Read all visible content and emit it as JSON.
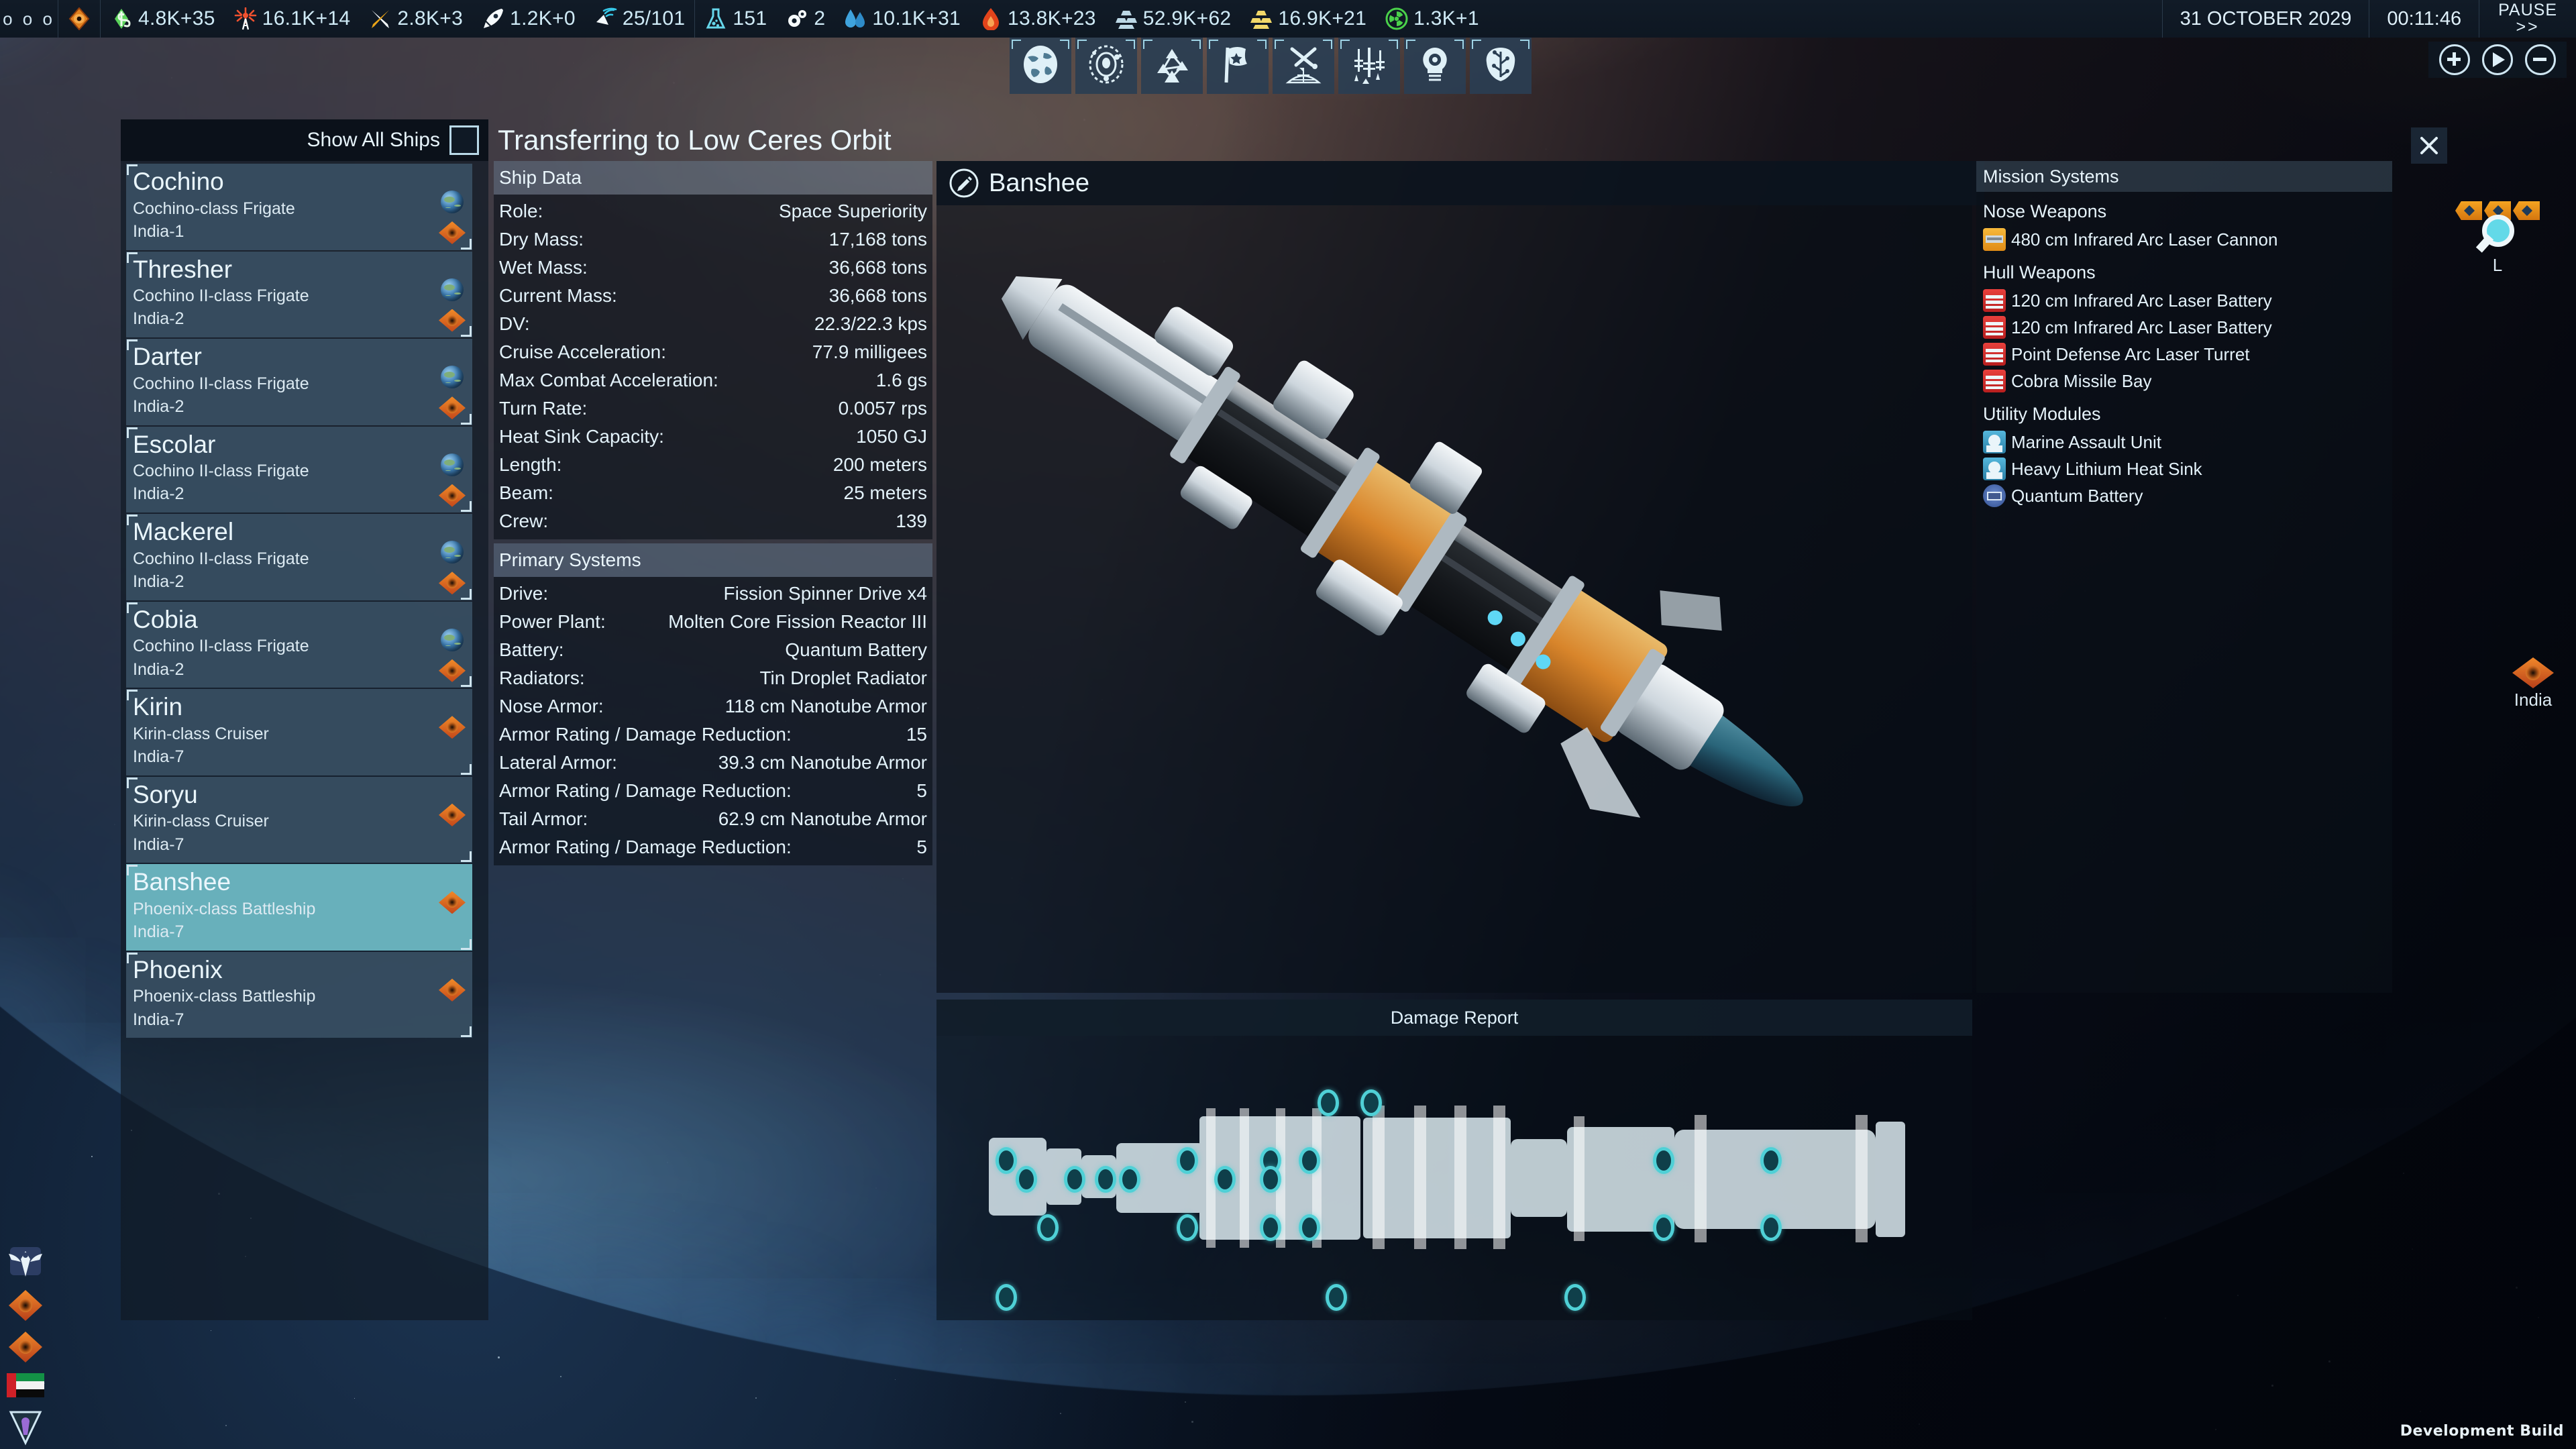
{
  "topbar": {
    "menu_dots": "o o o",
    "resources": [
      {
        "icon": "faction-eye-icon",
        "value": ""
      },
      {
        "icon": "money-icon",
        "value": "4.8K+35"
      },
      {
        "icon": "power-icon",
        "value": "16.1K+14"
      },
      {
        "icon": "metals-icon",
        "value": "2.8K+3"
      },
      {
        "icon": "rocket-icon",
        "value": "1.2K+0"
      },
      {
        "icon": "antenna-icon",
        "value": "25/101"
      },
      {
        "icon": "research-flask-icon",
        "value": "151"
      },
      {
        "icon": "gears-icon",
        "value": "2"
      },
      {
        "icon": "water-icon",
        "value": "10.1K+31"
      },
      {
        "icon": "volatiles-icon",
        "value": "13.8K+23"
      },
      {
        "icon": "metal-ingots-icon",
        "value": "52.9K+62"
      },
      {
        "icon": "gold-ingots-icon",
        "value": "16.9K+21"
      },
      {
        "icon": "fissiles-icon",
        "value": "1.3K+1"
      }
    ],
    "date": "31 OCTOBER 2029",
    "clock": "00:11:46",
    "pause_line1": "PAUSE",
    "pause_line2": ">>"
  },
  "toolbar": {
    "items": [
      {
        "name": "globe-icon",
        "label": "Earth"
      },
      {
        "name": "solar-system-icon",
        "label": "System"
      },
      {
        "name": "network-icon",
        "label": "Intel"
      },
      {
        "name": "flag-icon",
        "label": "Factions"
      },
      {
        "name": "crossed-swords-icon",
        "label": "Military"
      },
      {
        "name": "ships-icon",
        "label": "Fleets"
      },
      {
        "name": "lightbulb-gear-icon",
        "label": "Projects"
      },
      {
        "name": "brain-tech-icon",
        "label": "Research"
      }
    ]
  },
  "zoom_controls": {
    "zoom_in": "+",
    "play": "▶",
    "zoom_out": "−"
  },
  "window": {
    "title": "Transferring to Low Ceres Orbit",
    "close_label": "×"
  },
  "ship_list": {
    "show_all_label": "Show All Ships",
    "show_all_checked": false,
    "ships": [
      {
        "name": "Cochino",
        "class": "Cochino-class Frigate",
        "location": "India-1",
        "selected": false,
        "has_earth_badge": true
      },
      {
        "name": "Thresher",
        "class": "Cochino II-class Frigate",
        "location": "India-2",
        "selected": false,
        "has_earth_badge": true
      },
      {
        "name": "Darter",
        "class": "Cochino II-class Frigate",
        "location": "India-2",
        "selected": false,
        "has_earth_badge": true
      },
      {
        "name": "Escolar",
        "class": "Cochino II-class Frigate",
        "location": "India-2",
        "selected": false,
        "has_earth_badge": true
      },
      {
        "name": "Mackerel",
        "class": "Cochino II-class Frigate",
        "location": "India-2",
        "selected": false,
        "has_earth_badge": true
      },
      {
        "name": "Cobia",
        "class": "Cochino II-class Frigate",
        "location": "India-2",
        "selected": false,
        "has_earth_badge": true
      },
      {
        "name": "Kirin",
        "class": "Kirin-class Cruiser",
        "location": "India-7",
        "selected": false,
        "has_earth_badge": false
      },
      {
        "name": "Soryu",
        "class": "Kirin-class Cruiser",
        "location": "India-7",
        "selected": false,
        "has_earth_badge": false
      },
      {
        "name": "Banshee",
        "class": "Phoenix-class Battleship",
        "location": "India-7",
        "selected": true,
        "has_earth_badge": false
      },
      {
        "name": "Phoenix",
        "class": "Phoenix-class Battleship",
        "location": "India-7",
        "selected": false,
        "has_earth_badge": false
      }
    ]
  },
  "ship_data": {
    "section_title": "Ship Data",
    "rows": [
      {
        "key": "Role:",
        "value": "Space Superiority"
      },
      {
        "key": "Dry Mass:",
        "value": "17,168 tons"
      },
      {
        "key": "Wet Mass:",
        "value": "36,668 tons"
      },
      {
        "key": "Current Mass:",
        "value": "36,668 tons"
      },
      {
        "key": "DV:",
        "value": "22.3/22.3 kps"
      },
      {
        "key": "Cruise Acceleration:",
        "value": "77.9 milligees"
      },
      {
        "key": "Max Combat Acceleration:",
        "value": "1.6 gs"
      },
      {
        "key": "Turn Rate:",
        "value": "0.0057 rps"
      },
      {
        "key": "Heat Sink Capacity:",
        "value": "1050 GJ"
      },
      {
        "key": "Length:",
        "value": "200 meters"
      },
      {
        "key": "Beam:",
        "value": "25 meters"
      },
      {
        "key": "Crew:",
        "value": "139"
      }
    ]
  },
  "primary_systems": {
    "section_title": "Primary Systems",
    "rows": [
      {
        "key": "Drive:",
        "value": "Fission Spinner Drive x4"
      },
      {
        "key": "Power Plant:",
        "value": "Molten Core Fission Reactor III"
      },
      {
        "key": "Battery:",
        "value": "Quantum Battery"
      },
      {
        "key": "Radiators:",
        "value": "Tin Droplet Radiator"
      },
      {
        "key": "Nose Armor:",
        "value": "118 cm Nanotube Armor"
      },
      {
        "key": "Armor Rating / Damage Reduction:",
        "value": "15"
      },
      {
        "key": "Lateral Armor:",
        "value": "39.3 cm Nanotube Armor"
      },
      {
        "key": "Armor Rating / Damage Reduction:",
        "value": "5"
      },
      {
        "key": "Tail Armor:",
        "value": "62.9 cm Nanotube Armor"
      },
      {
        "key": "Armor Rating / Damage Reduction:",
        "value": "5"
      }
    ]
  },
  "viewer": {
    "ship_name": "Banshee",
    "edit_icon": "pencil-icon"
  },
  "damage_report": {
    "title": "Damage Report"
  },
  "mission_systems": {
    "section_title": "Mission Systems",
    "groups": [
      {
        "title": "Nose Weapons",
        "items": [
          {
            "label": "480 cm Infrared Arc Laser Cannon",
            "icon": "laser-cannon-icon",
            "color": "orange"
          }
        ]
      },
      {
        "title": "Hull Weapons",
        "items": [
          {
            "label": "120 cm Infrared Arc Laser Battery",
            "icon": "laser-battery-icon",
            "color": "red"
          },
          {
            "label": "120 cm Infrared Arc Laser Battery",
            "icon": "laser-battery-icon",
            "color": "red"
          },
          {
            "label": "Point Defense Arc Laser Turret",
            "icon": "pd-turret-icon",
            "color": "red"
          },
          {
            "label": "Cobra Missile Bay",
            "icon": "missile-bay-icon",
            "color": "red"
          }
        ]
      },
      {
        "title": "Utility Modules",
        "items": [
          {
            "label": "Marine Assault Unit",
            "icon": "marine-icon",
            "color": "blue"
          },
          {
            "label": "Heavy Lithium Heat Sink",
            "icon": "heatsink-icon",
            "color": "blue"
          },
          {
            "label": "Quantum Battery",
            "icon": "battery-icon",
            "color": "navy"
          }
        ]
      }
    ]
  },
  "map_markers": {
    "left_label": "L",
    "india_label": "India"
  },
  "footer": {
    "dev_build": "Development Build"
  },
  "colors": {
    "accent_cyan": "#4fd0d6",
    "selection": "#68b0bb",
    "panel": "#384f63",
    "text": "#e4f2fa",
    "faction_orange": "#e0801f"
  }
}
